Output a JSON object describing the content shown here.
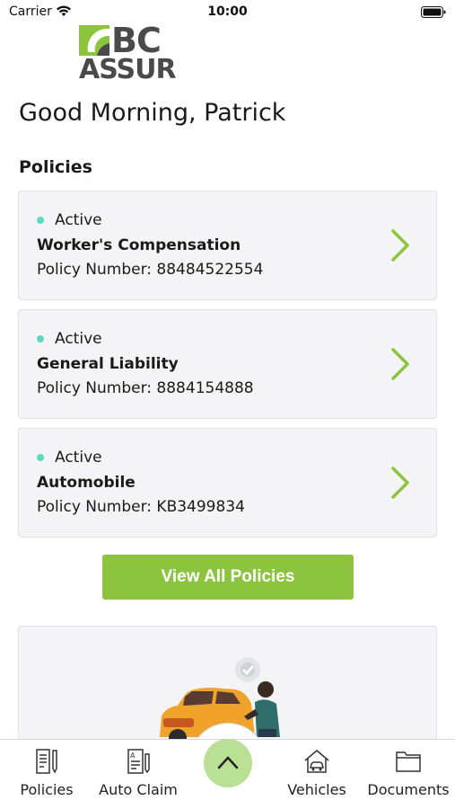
{
  "status_bar": {
    "carrier": "Carrier",
    "time": "10:00"
  },
  "brand": {
    "line1": "BC",
    "line2": "ASSUR",
    "accent_color": "#8cc43f"
  },
  "greeting": "Good Morning, Patrick",
  "policies_section": {
    "title": "Policies",
    "items": [
      {
        "status": "Active",
        "name": "Worker's Compensation",
        "number": "Policy Number: 88484522554"
      },
      {
        "status": "Active",
        "name": "General Liability",
        "number": "Policy Number: 8884154888"
      },
      {
        "status": "Active",
        "name": "Automobile",
        "number": "Policy Number: KB3499834"
      }
    ],
    "view_all_label": "View All Policies"
  },
  "tab_bar": {
    "tabs": [
      {
        "label": "Policies",
        "icon": "policy-document-icon"
      },
      {
        "label": "Auto Claim",
        "icon": "claim-form-icon"
      },
      {
        "label": "Vehicles",
        "icon": "car-house-icon"
      },
      {
        "label": "Documents",
        "icon": "folder-icon"
      }
    ],
    "center_action_icon": "chevron-up-icon"
  },
  "colors": {
    "active_dot": "#5ed6c0",
    "chevron": "#8cc43f",
    "card_bg": "#f4f4f6"
  }
}
